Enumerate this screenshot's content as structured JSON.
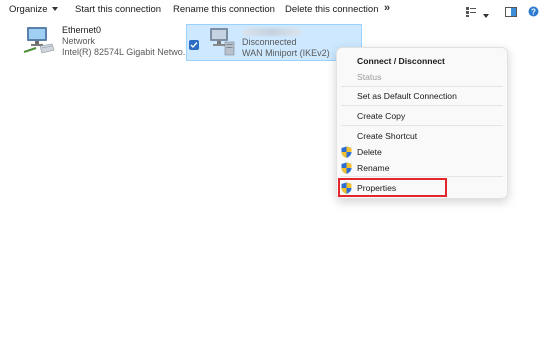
{
  "toolbar": {
    "organize_label": "Organize",
    "start_label": "Start this connection",
    "rename_label": "Rename this connection",
    "delete_label": "Delete this connection",
    "more_label": "»"
  },
  "connections": [
    {
      "name": "Ethernet0",
      "type": "Network",
      "device": "Intel(R) 82574L Gigabit Netwo...",
      "selected": false
    },
    {
      "name": "",
      "status": "Disconnected",
      "device": "WAN Miniport (IKEv2)",
      "selected": true
    }
  ],
  "context_menu": {
    "items": [
      {
        "label": "Connect / Disconnect",
        "bold": true
      },
      {
        "label": "Status",
        "disabled": true
      },
      {
        "label": "Set as Default Connection"
      },
      {
        "label": "Create Copy"
      },
      {
        "label": "Create Shortcut"
      },
      {
        "label": "Delete",
        "icon": "shield-icon"
      },
      {
        "label": "Rename",
        "icon": "shield-icon"
      },
      {
        "label": "Properties",
        "icon": "shield-icon",
        "highlighted": true
      }
    ]
  },
  "colors": {
    "selection_bg": "#cde8ff",
    "selection_border": "#99d1ff",
    "highlight_border": "#e3262b",
    "checkbox": "#2b6cc4"
  }
}
